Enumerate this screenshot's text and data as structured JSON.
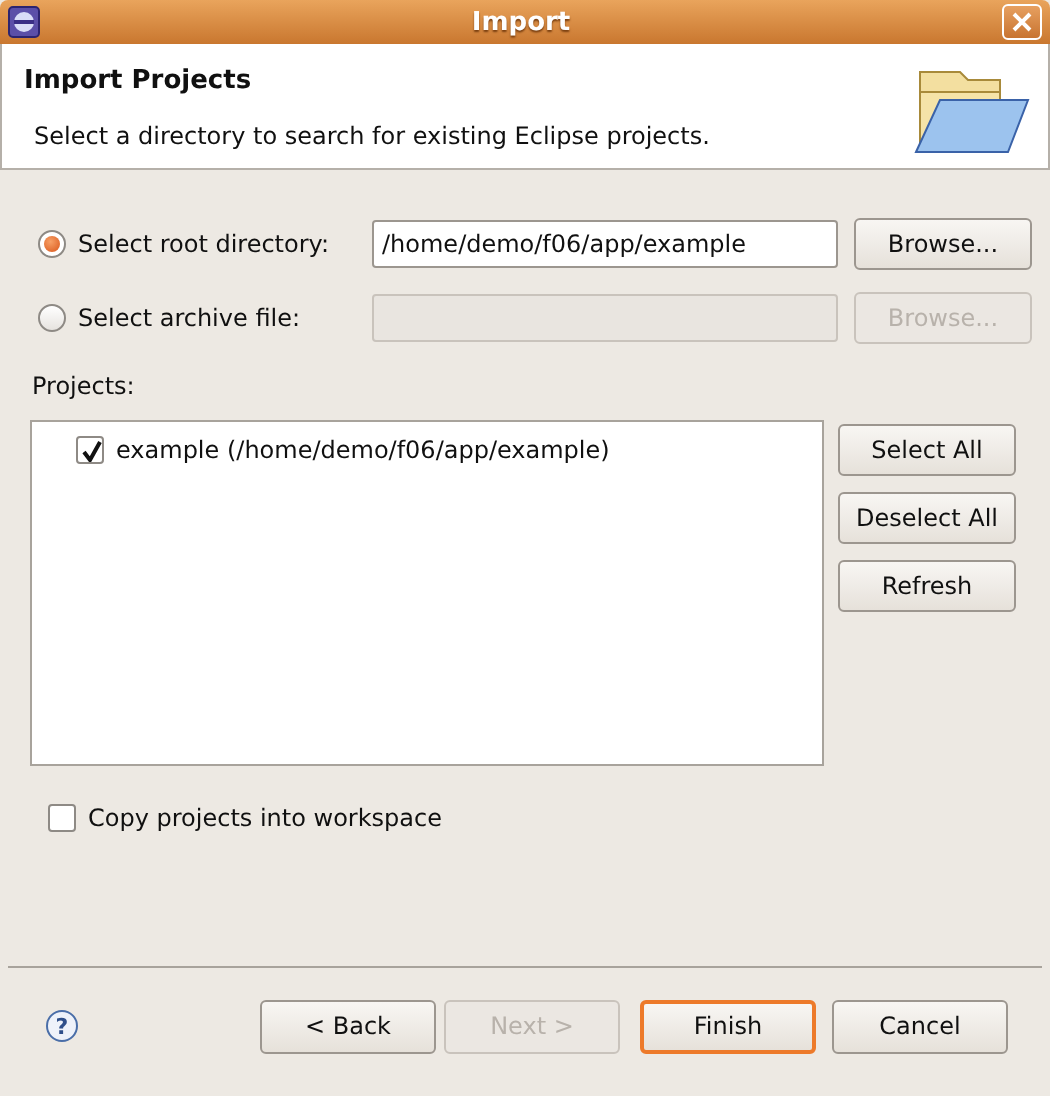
{
  "window": {
    "title": "Import"
  },
  "header": {
    "title": "Import Projects",
    "description": "Select a directory to search for existing Eclipse projects."
  },
  "source_options": [
    {
      "label": "Select root directory:",
      "selected": true,
      "value": "/home/demo/f06/app/example",
      "disabled": false,
      "browse": "Browse..."
    },
    {
      "label": "Select archive file:",
      "selected": false,
      "disabled": true,
      "browse": "Browse..."
    }
  ],
  "projects": {
    "label": "Projects:",
    "items": [
      {
        "label": "example (/home/demo/f06/app/example)",
        "checked": true
      }
    ],
    "buttons": [
      "Select All",
      "Deselect All",
      "Refresh"
    ]
  },
  "copy_into_workspace": {
    "label": "Copy projects into workspace",
    "checked": false
  },
  "footer": {
    "help": "?",
    "buttons": [
      {
        "label": "< Back",
        "disabled": false,
        "default": false
      },
      {
        "label": "Next >",
        "disabled": true,
        "default": false
      },
      {
        "label": "Finish",
        "disabled": false,
        "default": true
      },
      {
        "label": "Cancel",
        "disabled": false,
        "default": false
      }
    ]
  }
}
